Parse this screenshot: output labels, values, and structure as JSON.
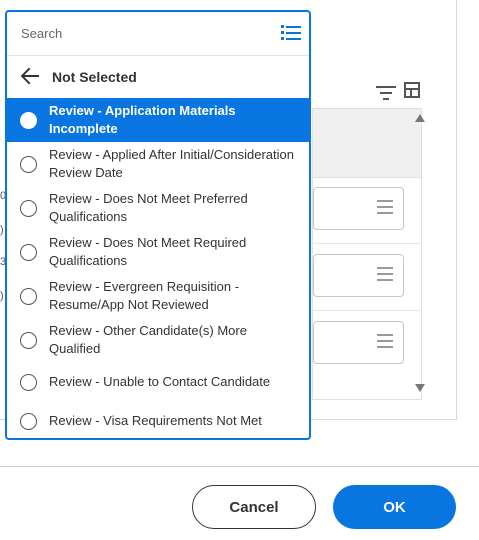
{
  "dropdown": {
    "search_placeholder": "Search",
    "search_value": "",
    "header_title": "Not Selected",
    "options": [
      {
        "label": "Review - Application Materials Incomplete",
        "selected": true
      },
      {
        "label": "Review - Applied After Initial/Consideration Review Date",
        "selected": false
      },
      {
        "label": "Review - Does Not Meet Preferred Qualifications",
        "selected": false
      },
      {
        "label": "Review - Does Not Meet Required Qualifications",
        "selected": false
      },
      {
        "label": "Review - Evergreen Requisition - Resume/App Not Reviewed",
        "selected": false
      },
      {
        "label": "Review - Other Candidate(s) More Qualified",
        "selected": false
      },
      {
        "label": "Review - Unable to Contact Candidate",
        "selected": false
      },
      {
        "label": "Review - Visa Requirements Not Met",
        "selected": false
      }
    ]
  },
  "footer": {
    "cancel_label": "Cancel",
    "ok_label": "OK"
  },
  "background": {
    "left_fragments": [
      "0",
      ")",
      "3",
      ")"
    ]
  },
  "colors": {
    "accent": "#0875e1",
    "text": "#333333",
    "border": "#d9d9d9"
  }
}
